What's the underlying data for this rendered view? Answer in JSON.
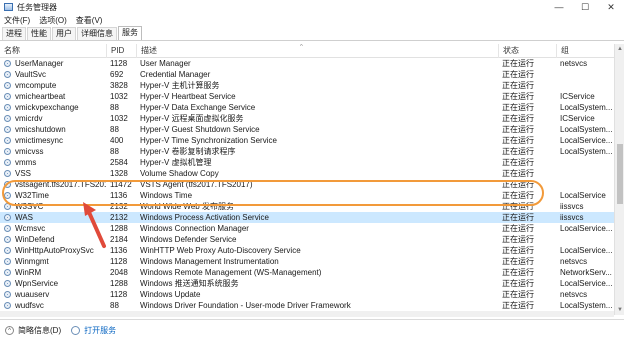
{
  "window": {
    "title": "任务管理器",
    "minimize_glyph": "—",
    "maximize_glyph": "☐",
    "close_glyph": "✕"
  },
  "menu": [
    "文件(F)",
    "选项(O)",
    "查看(V)"
  ],
  "tabs": [
    "进程",
    "性能",
    "用户",
    "详细信息",
    "服务"
  ],
  "active_tab": 4,
  "columns": {
    "name": "名称",
    "pid": "PID",
    "desc": "描述",
    "status": "状态",
    "group": "组"
  },
  "rows": [
    {
      "name": "UserManager",
      "pid": "1128",
      "desc": "User Manager",
      "status": "正在运行",
      "group": "netsvcs"
    },
    {
      "name": "VaultSvc",
      "pid": "692",
      "desc": "Credential Manager",
      "status": "正在运行",
      "group": ""
    },
    {
      "name": "vmcompute",
      "pid": "3828",
      "desc": "Hyper-V 主机计算服务",
      "status": "正在运行",
      "group": ""
    },
    {
      "name": "vmicheartbeat",
      "pid": "1032",
      "desc": "Hyper-V Heartbeat Service",
      "status": "正在运行",
      "group": "ICService"
    },
    {
      "name": "vmickvpexchange",
      "pid": "88",
      "desc": "Hyper-V Data Exchange Service",
      "status": "正在运行",
      "group": "LocalSystem..."
    },
    {
      "name": "vmicrdv",
      "pid": "1032",
      "desc": "Hyper-V 远程桌面虚拟化服务",
      "status": "正在运行",
      "group": "ICService"
    },
    {
      "name": "vmicshutdown",
      "pid": "88",
      "desc": "Hyper-V Guest Shutdown Service",
      "status": "正在运行",
      "group": "LocalSystem..."
    },
    {
      "name": "vmictimesync",
      "pid": "400",
      "desc": "Hyper-V Time Synchronization Service",
      "status": "正在运行",
      "group": "LocalService..."
    },
    {
      "name": "vmicvss",
      "pid": "88",
      "desc": "Hyper-V 卷影复制请求程序",
      "status": "正在运行",
      "group": "LocalSystem..."
    },
    {
      "name": "vmms",
      "pid": "2584",
      "desc": "Hyper-V 虚拟机管理",
      "status": "正在运行",
      "group": ""
    },
    {
      "name": "VSS",
      "pid": "1328",
      "desc": "Volume Shadow Copy",
      "status": "正在运行",
      "group": ""
    },
    {
      "name": "vstsagent.tfs2017.TFS2017",
      "pid": "11472",
      "desc": "VSTS Agent (tfs2017.TFS2017)",
      "status": "正在运行",
      "group": ""
    },
    {
      "name": "W32Time",
      "pid": "1136",
      "desc": "Windows Time",
      "status": "正在运行",
      "group": "LocalService"
    },
    {
      "name": "W3SVC",
      "pid": "2132",
      "desc": "World Wide Web 发布服务",
      "status": "正在运行",
      "group": "iissvcs"
    },
    {
      "name": "WAS",
      "pid": "2132",
      "desc": "Windows Process Activation Service",
      "status": "正在运行",
      "group": "iissvcs"
    },
    {
      "name": "Wcmsvc",
      "pid": "1288",
      "desc": "Windows Connection Manager",
      "status": "正在运行",
      "group": "LocalService..."
    },
    {
      "name": "WinDefend",
      "pid": "2184",
      "desc": "Windows Defender Service",
      "status": "正在运行",
      "group": ""
    },
    {
      "name": "WinHttpAutoProxySvc",
      "pid": "1136",
      "desc": "WinHTTP Web Proxy Auto-Discovery Service",
      "status": "正在运行",
      "group": "LocalService..."
    },
    {
      "name": "Winmgmt",
      "pid": "1128",
      "desc": "Windows Management Instrumentation",
      "status": "正在运行",
      "group": "netsvcs"
    },
    {
      "name": "WinRM",
      "pid": "2048",
      "desc": "Windows Remote Management (WS-Management)",
      "status": "正在运行",
      "group": "NetworkServ..."
    },
    {
      "name": "WpnService",
      "pid": "1288",
      "desc": "Windows 推送通知系统服务",
      "status": "正在运行",
      "group": "LocalService..."
    },
    {
      "name": "wuauserv",
      "pid": "1128",
      "desc": "Windows Update",
      "status": "正在运行",
      "group": "netsvcs"
    },
    {
      "name": "wudfsvc",
      "pid": "88",
      "desc": "Windows Driver Foundation - User-mode Driver Framework",
      "status": "正在运行",
      "group": "LocalSystem..."
    }
  ],
  "selected_row": 14,
  "footer": {
    "fewer_details": "简略信息(D)",
    "open_services": "打开服务"
  },
  "colors": {
    "selection": "#cce8ff",
    "highlight_ring": "#f29a3a",
    "arrow": "#e04a3a",
    "link": "#0a66c2"
  }
}
